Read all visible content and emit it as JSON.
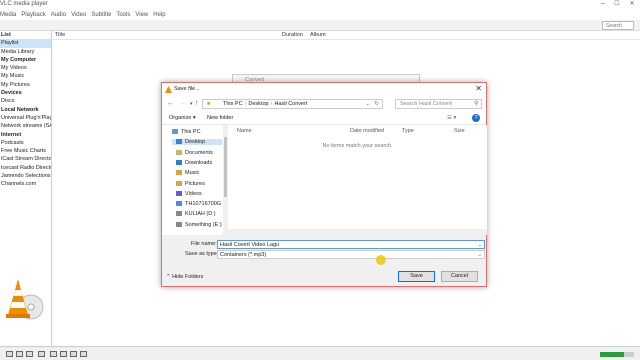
{
  "window": {
    "title": "VLC media player",
    "search_placeholder": "Search"
  },
  "menu": [
    "Media",
    "Playback",
    "Audio",
    "Video",
    "Subtitle",
    "Tools",
    "View",
    "Help"
  ],
  "sidebar": [
    {
      "label": "List",
      "cat": true
    },
    {
      "label": "Playlist",
      "sel": true
    },
    {
      "label": "Media Library"
    },
    {
      "label": "My Computer",
      "cat": true
    },
    {
      "label": "My Videos"
    },
    {
      "label": "My Music"
    },
    {
      "label": "My Pictures"
    },
    {
      "label": "Devices",
      "cat": true
    },
    {
      "label": "Discs"
    },
    {
      "label": "Local Network",
      "cat": true
    },
    {
      "label": "Universal Plug'n'Play"
    },
    {
      "label": "Network streams (SAP)"
    },
    {
      "label": "Internet",
      "cat": true
    },
    {
      "label": "Podcasts"
    },
    {
      "label": "Free Music Charts"
    },
    {
      "label": "iCast Stream Directory"
    },
    {
      "label": "Icecast Radio Directory"
    },
    {
      "label": "Jamendo Selections"
    },
    {
      "label": "Channels.com"
    }
  ],
  "playlist_headers": {
    "title": "Title",
    "duration": "Duration",
    "album": "Album"
  },
  "convert_dialog": {
    "title": "Convert"
  },
  "save_dialog": {
    "title": "Save file...",
    "address": {
      "root": "This PC",
      "folder1": "Desktop",
      "folder2": "Hasil Convert"
    },
    "search_placeholder": "Search Hasil Convert",
    "organize": "Organize ▾",
    "new_folder": "New folder",
    "help": "?",
    "nav_items": [
      {
        "label": "This PC",
        "icon": "pc-icon",
        "color": "#5b9bd5"
      },
      {
        "label": "Desktop",
        "icon": "desktop-icon",
        "color": "#3a86c8",
        "sel": true
      },
      {
        "label": "Documents",
        "icon": "documents-icon",
        "color": "#c8b36a"
      },
      {
        "label": "Downloads",
        "icon": "downloads-icon",
        "color": "#2f7fd0"
      },
      {
        "label": "Music",
        "icon": "music-icon",
        "color": "#d9a441"
      },
      {
        "label": "Pictures",
        "icon": "pictures-icon",
        "color": "#d9a441"
      },
      {
        "label": "Videos",
        "icon": "videos-icon",
        "color": "#6a5acd"
      },
      {
        "label": "TH10716700G (C:)",
        "icon": "drive-icon",
        "color": "#4a90d9"
      },
      {
        "label": "KULIAH (D:)",
        "icon": "drive-icon",
        "color": "#888888"
      },
      {
        "label": "Something (E:)",
        "icon": "drive-icon",
        "color": "#888888"
      }
    ],
    "columns": {
      "name": "Name",
      "date": "Date modified",
      "type": "Type",
      "size": "Size"
    },
    "empty_text": "No items match your search.",
    "file_name_label": "File name:",
    "file_name_value": "Hasil Covert Video Lagu",
    "save_type_label": "Save as type:",
    "save_type_value": "Containers (*.mp3)",
    "hide_folders": "Hide Folders",
    "save_button": "Save",
    "cancel_button": "Cancel"
  },
  "accent": "#0078d7"
}
